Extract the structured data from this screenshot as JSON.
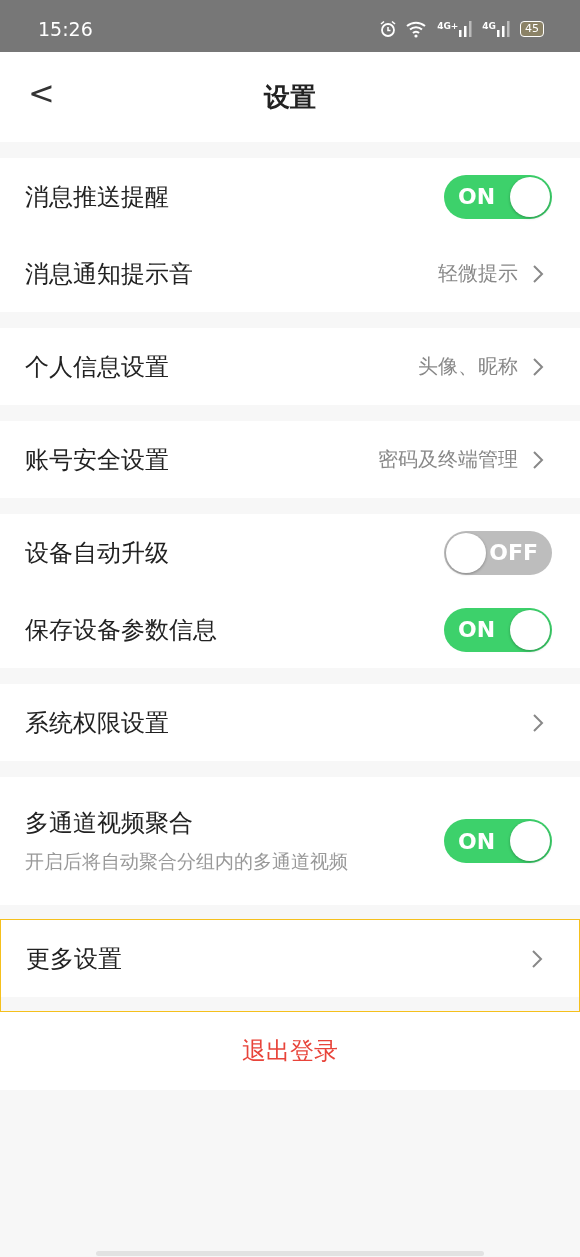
{
  "status_bar": {
    "time": "15:26",
    "signals": [
      {
        "label": "4G+"
      },
      {
        "label": "4G"
      }
    ],
    "battery": "45"
  },
  "header": {
    "back": "<",
    "title": "设置"
  },
  "groups": [
    {
      "highlighted": false,
      "rows": [
        {
          "kind": "toggle",
          "title": "消息推送提醒",
          "on": true,
          "label": "ON"
        },
        {
          "kind": "link",
          "title": "消息通知提示音",
          "value": "轻微提示"
        }
      ]
    },
    {
      "highlighted": false,
      "rows": [
        {
          "kind": "link",
          "title": "个人信息设置",
          "value": "头像、昵称"
        }
      ]
    },
    {
      "highlighted": false,
      "rows": [
        {
          "kind": "link",
          "title": "账号安全设置",
          "value": "密码及终端管理"
        }
      ]
    },
    {
      "highlighted": false,
      "rows": [
        {
          "kind": "toggle",
          "title": "设备自动升级",
          "on": false,
          "label": "OFF"
        },
        {
          "kind": "toggle",
          "title": "保存设备参数信息",
          "on": true,
          "label": "ON"
        }
      ]
    },
    {
      "highlighted": false,
      "rows": [
        {
          "kind": "link",
          "title": "系统权限设置"
        }
      ]
    },
    {
      "highlighted": false,
      "rows": [
        {
          "kind": "toggle",
          "title": "多通道视频聚合",
          "subtitle": "开启后将自动聚合分组内的多通道视频",
          "on": true,
          "label": "ON"
        }
      ]
    },
    {
      "highlighted": true,
      "rows": [
        {
          "kind": "link",
          "title": "更多设置"
        }
      ]
    }
  ],
  "logout": "退出登录"
}
